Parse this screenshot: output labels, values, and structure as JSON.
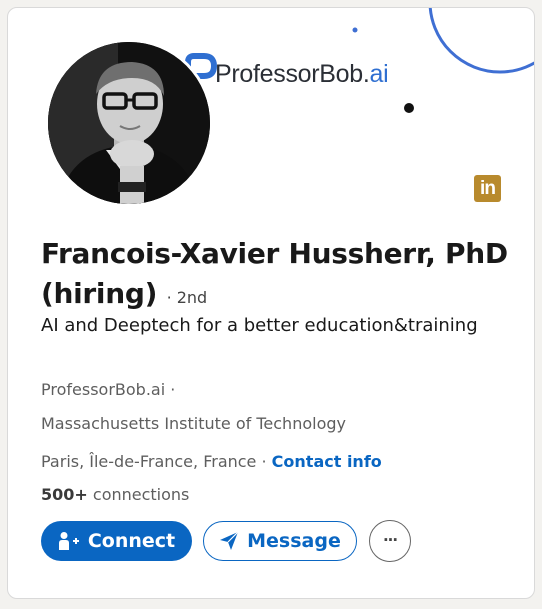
{
  "banner": {
    "logo_main": "ProfessorBob.",
    "logo_accent": "ai",
    "linkedin_badge": "in"
  },
  "profile": {
    "name": "Francois-Xavier Hussherr, PhD (hiring)",
    "degree": "· 2nd",
    "headline": "AI and Deeptech for a better education&training",
    "company": "ProfessorBob.ai ·",
    "school": "Massachusetts Institute of Technology",
    "location": "Paris, Île-de-France, France ·",
    "contact_info": "Contact info",
    "connections_count": "500+",
    "connections_label": " connections"
  },
  "actions": {
    "connect": "Connect",
    "message": "Message",
    "more": "···"
  },
  "colors": {
    "brand_blue": "#0a66c2",
    "logo_blue": "#2f6fd1",
    "badge_gold": "#b88a2d"
  },
  "icons": {
    "connect": "add-person-icon",
    "message": "send-icon",
    "more": "more-icon",
    "linkedin": "linkedin-icon"
  }
}
